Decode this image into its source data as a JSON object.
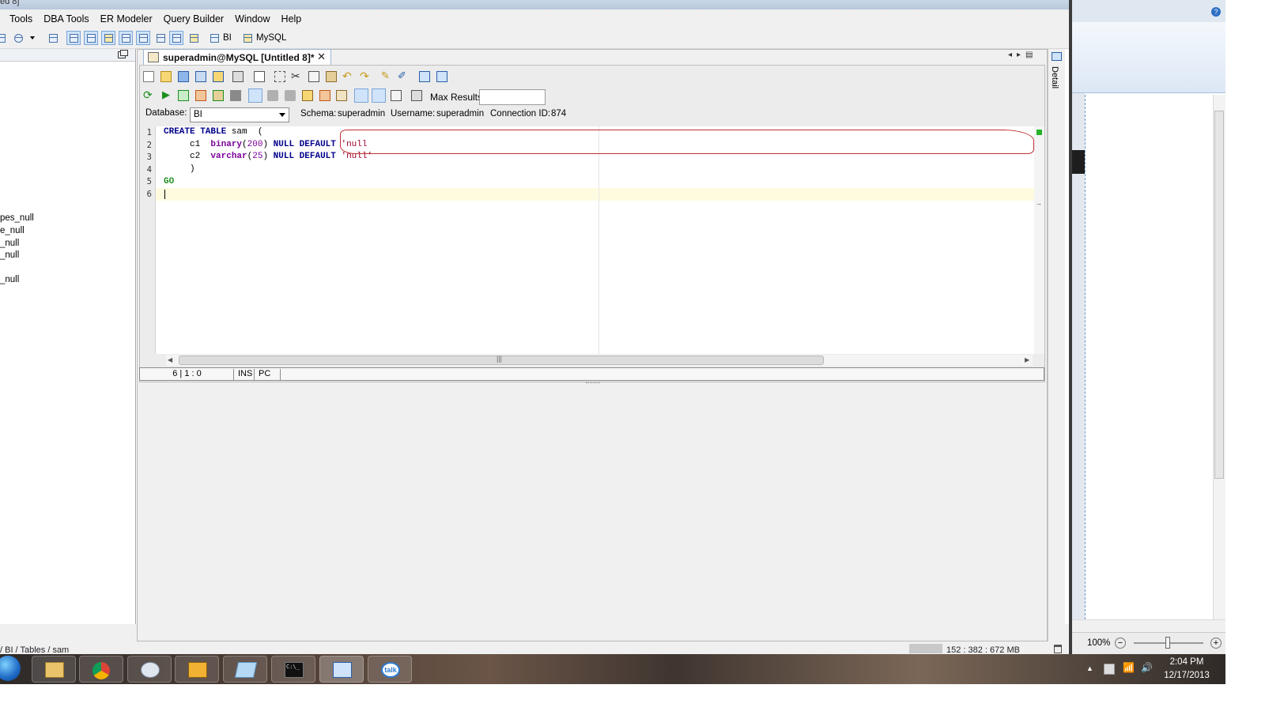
{
  "window": {
    "title_fragment": "ed 8]"
  },
  "menu": [
    "Tools",
    "DBA Tools",
    "ER Modeler",
    "Query Builder",
    "Window",
    "Help"
  ],
  "toolbar_top": {
    "bi_label": "BI",
    "mysql_label": "MySQL"
  },
  "left_panel": {
    "tree_items": [
      "pes_null",
      "e_null",
      "_null",
      "_null",
      "_null"
    ],
    "breadcrumb": "/ BI / Tables / sam"
  },
  "tab": {
    "label": "superadmin@MySQL [Untitled 8]*"
  },
  "editor": {
    "max_results_label": "Max Results:",
    "max_results_value": "",
    "database_label": "Database:",
    "database_value": "BI",
    "schema_label": "Schema:",
    "schema_value": "superadmin",
    "username_label": "Username:",
    "username_value": "superadmin",
    "connection_label": "Connection ID:",
    "connection_value": "874",
    "line_numbers": [
      "1",
      "2",
      "3",
      "4",
      "5",
      "6"
    ],
    "code": {
      "l1_kw": "CREATE TABLE",
      "l1_name": " sam  (",
      "l2_col": "     c1  ",
      "l2_type": "binary",
      "l2_paren_open": "(",
      "l2_num": "200",
      "l2_paren_close": ")",
      "l2_kw": " NULL DEFAULT ",
      "l2_str": "'null",
      "l3_col": "     c2  ",
      "l3_type": "varchar",
      "l3_paren_open": "(",
      "l3_num": "25",
      "l3_paren_close": ")",
      "l3_kw": " NULL DEFAULT ",
      "l3_str": "'null'",
      "l4": "     )",
      "l5_go": "GO"
    }
  },
  "status": {
    "position": "6 | 1 : 0",
    "mode": "INS",
    "line_ending": "PC"
  },
  "footer": {
    "memory": "152 : 382 : 672 MB"
  },
  "detail_label": "Detail",
  "right_window": {
    "zoom": "100%",
    "zoom_level": 0.45
  },
  "taskbar": {
    "apps": [
      "windows-explorer",
      "chrome",
      "paint",
      "puzzle-app",
      "notepad-app",
      "command-prompt",
      "database-app",
      "google-talk"
    ],
    "talk_label": "talk",
    "cmd_label": "C:\\_",
    "time": "2:04 PM",
    "date": "12/17/2013"
  },
  "colors": {
    "keyword": "#00008b",
    "type": "#7b0099",
    "string": "#a0002a",
    "go": "#1d8f1d",
    "annotation": "#c03030"
  }
}
